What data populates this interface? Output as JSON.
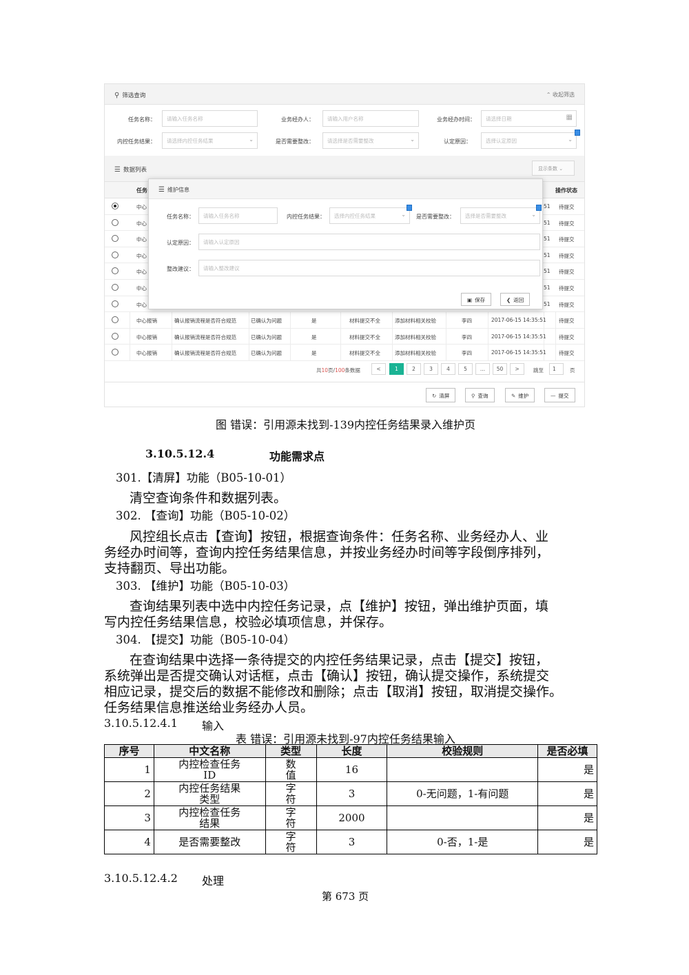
{
  "screenshot": {
    "filter_panel": {
      "title": "筛选查询",
      "collapse_label": "收起筛选",
      "fields": [
        {
          "label": "任务名称：",
          "placeholder": "请输入任务名称"
        },
        {
          "label": "业务经办人：",
          "placeholder": "请输入用户名称"
        },
        {
          "label": "业务经办时间：",
          "placeholder": "请选择日期"
        },
        {
          "label": "内控任务结果：",
          "placeholder": "请选择内控任务结果"
        },
        {
          "label": "是否需要整改：",
          "placeholder": "请选择是否需要整改"
        },
        {
          "label": "认定原因：",
          "placeholder": "选择认定原因"
        }
      ]
    },
    "list_panel": {
      "title": "数据列表",
      "show_columns": "显示条数",
      "header_first": "任务",
      "header_last": "操作状态"
    },
    "rows": [
      {
        "selected": true,
        "col1": "中心",
        "time_tail": "51",
        "status": "待提交"
      },
      {
        "selected": false,
        "col1": "中心",
        "time_tail": "51",
        "status": "待提交"
      },
      {
        "selected": false,
        "col1": "中心",
        "time_tail": "51",
        "status": "待提交"
      },
      {
        "selected": false,
        "col1": "中心",
        "time_tail": "51",
        "status": "待提交"
      },
      {
        "selected": false,
        "col1": "中心",
        "time_tail": "51",
        "status": "待提交"
      },
      {
        "selected": false,
        "col1": "中心",
        "time_tail": "51",
        "status": "待提交"
      },
      {
        "selected": false,
        "col1": "中心",
        "time_tail": "51",
        "status": "待提交"
      }
    ],
    "full_rows": [
      {
        "c1": "中心报销",
        "c2": "确认报销流程是否符合规范",
        "c3": "已确认为问题",
        "c4": "是",
        "c5": "材料提交不全",
        "c6": "添加材料相关校验",
        "c7": "李四",
        "c8": "2017-06-15 14:35:51",
        "c9": "待提交"
      },
      {
        "c1": "中心报销",
        "c2": "确认报销流程是否符合规范",
        "c3": "已确认为问题",
        "c4": "是",
        "c5": "材料提交不全",
        "c6": "添加材料相关校验",
        "c7": "李四",
        "c8": "2017-06-15 14:35:51",
        "c9": "待提交"
      },
      {
        "c1": "中心报销",
        "c2": "确认报销流程是否符合规范",
        "c3": "已确认为问题",
        "c4": "是",
        "c5": "材料提交不全",
        "c6": "添加材料相关校验",
        "c7": "李四",
        "c8": "2017-06-15 14:35:51",
        "c9": "待提交"
      }
    ],
    "modal": {
      "title": "维护信息",
      "task_name_label": "任务名称：",
      "task_name_placeholder": "请输入任务名称",
      "result_label": "内控任务结果：",
      "result_placeholder": "选择内控任务结果",
      "rectify_label": "是否需要整改：",
      "rectify_placeholder": "选择是否需要整改",
      "reason_label": "认定原因：",
      "reason_placeholder": "请输入认定原因",
      "advice_label": "整改建议：",
      "advice_placeholder": "请输入整改建议",
      "save_label": "保存",
      "back_label": "返回"
    },
    "pager": {
      "summary_prefix": "共",
      "summary_pages": "10",
      "summary_mid": "页/",
      "summary_records": "100",
      "summary_suffix": "条数据",
      "prev": "<",
      "pages": [
        "1",
        "2",
        "3",
        "4",
        "5",
        "...",
        "50"
      ],
      "next": ">",
      "goto_label": "跳至",
      "goto_value": "1",
      "goto_unit": "页"
    },
    "footer_buttons": {
      "clear": "清屏",
      "query": "查询",
      "maintain": "维护",
      "submit": "提交"
    }
  },
  "document": {
    "figure_caption": "图  错误：引用源未找到-139内控任务结果录入维护页",
    "section_number": "3.10.5.12.4",
    "section_title": "功能需求点",
    "items": [
      {
        "heading": "301.【清屏】功能（B05-10-01）",
        "body": [
          "清空查询条件和数据列表。"
        ]
      },
      {
        "heading": "302.  【查询】功能（B05-10-02）",
        "body": [
          "风控组长点击【查询】按钮，根据查询条件：任务名称、业务经办人、业",
          "务经办时间等，查询内控任务结果信息，并按业务经办时间等字段倒序排列，",
          "支持翻页、导出功能。"
        ]
      },
      {
        "heading": "303.  【维护】功能（B05-10-03）",
        "body": [
          "查询结果列表中选中内控任务记录，点【维护】按钮，弹出维护页面，填",
          "写内控任务结果信息，校验必填项信息，并保存。"
        ]
      },
      {
        "heading": "304.  【提交】功能（B05-10-04）",
        "body": [
          "在查询结果中选择一条待提交的内控任务结果记录，点击【提交】按钮，",
          "系统弹出是否提交确认对话框，点击【确认】按钮，确认提交操作，系统提交",
          "相应记录，提交后的数据不能修改和删除；点击【取消】按钮，取消提交操作。",
          "任务结果信息推送给业务经办人员。"
        ]
      }
    ],
    "input_heading_num": "3.10.5.12.4.1",
    "input_heading_title": "输入",
    "table_caption": "表  错误：引用源未找到-97内控任务结果输入",
    "table_headers": [
      "序号",
      "中文名称",
      "类型",
      "长度",
      "校验规则",
      "是否必填"
    ],
    "table_rows": [
      {
        "no": "1",
        "name": [
          "内控检查任务",
          "ID"
        ],
        "type": [
          "数",
          "值"
        ],
        "len": "16",
        "rule": "",
        "required": "是"
      },
      {
        "no": "2",
        "name": [
          "内控任务结果",
          "类型"
        ],
        "type": [
          "字",
          "符"
        ],
        "len": "3",
        "rule": "0-无问题，1-有问题",
        "required": "是"
      },
      {
        "no": "3",
        "name": [
          "内控检查任务",
          "结果"
        ],
        "type": [
          "字",
          "符"
        ],
        "len": "2000",
        "rule": "",
        "required": "是"
      },
      {
        "no": "4",
        "name": [
          "是否需要整改"
        ],
        "type": [
          "字",
          "符"
        ],
        "len": "3",
        "rule": "0-否，1-是",
        "required": "是"
      }
    ],
    "process_heading_num": "3.10.5.12.4.2",
    "process_heading_title": "处理",
    "page_number": "第  673  页"
  }
}
